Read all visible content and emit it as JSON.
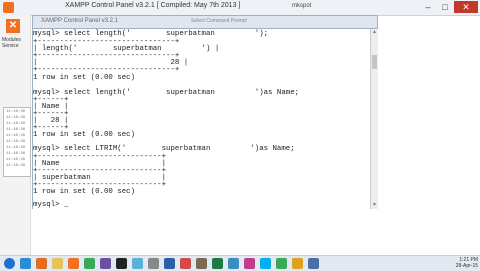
{
  "background_window": {
    "title": "XAMPP Control Panel v3.2.1   [ Compiled: May 7th 2013 ]",
    "mini_title": "mkspot",
    "modules_label": "Modules Service",
    "log_lines": [
      "11:48:36",
      "11:48:36",
      "11:48:36",
      "11:48:36",
      "11:48:36",
      "11:48:36",
      "11:48:36",
      "11:48:36",
      "11:48:36",
      "11:48:36"
    ]
  },
  "cmd_window": {
    "title": "XAMPP Control Panel v3.2.1",
    "title_center": "Select Command Prompt"
  },
  "terminal": {
    "lines": [
      "mysql> select length('        superbatman         ');",
      "+-------------------------------+",
      "| length('        superbatman         ') |",
      "+-------------------------------+",
      "|                              28 |",
      "+-------------------------------+",
      "1 row in set (0.00 sec)",
      "",
      "mysql> select length('        superbatman         ')as Name;",
      "+------+",
      "| Name |",
      "+------+",
      "|   28 |",
      "+------+",
      "1 row in set (0.00 sec)",
      "",
      "mysql> select LTRIM('        superbatman         ')as Name;",
      "+----------------------------+",
      "| Name                       |",
      "+----------------------------+",
      "| superbatman                |",
      "+----------------------------+",
      "1 row in set (0.00 sec)",
      "",
      "mysql> _"
    ]
  },
  "window_controls": {
    "minimize": "–",
    "maximize": "□",
    "close": "✕"
  },
  "tray": {
    "time": "1:21 PM",
    "date": "28-Apr-15"
  },
  "colors": {
    "terminal_bg": "#ffffff",
    "terminal_text": "#222222",
    "accent": "#f37021",
    "close": "#c0392b"
  },
  "taskbar_icons": [
    "windows-start-icon",
    "browser-ie-icon",
    "firefox-icon",
    "folder-icon",
    "xampp-icon",
    "chrome-icon",
    "media-icon",
    "cmd-icon",
    "notepad-icon",
    "settings-icon",
    "word-icon",
    "paint-icon",
    "gimp-icon",
    "excel-icon",
    "network-icon",
    "audio-icon",
    "skype-icon",
    "chrome-icon-2",
    "music-icon",
    "app-icon"
  ]
}
